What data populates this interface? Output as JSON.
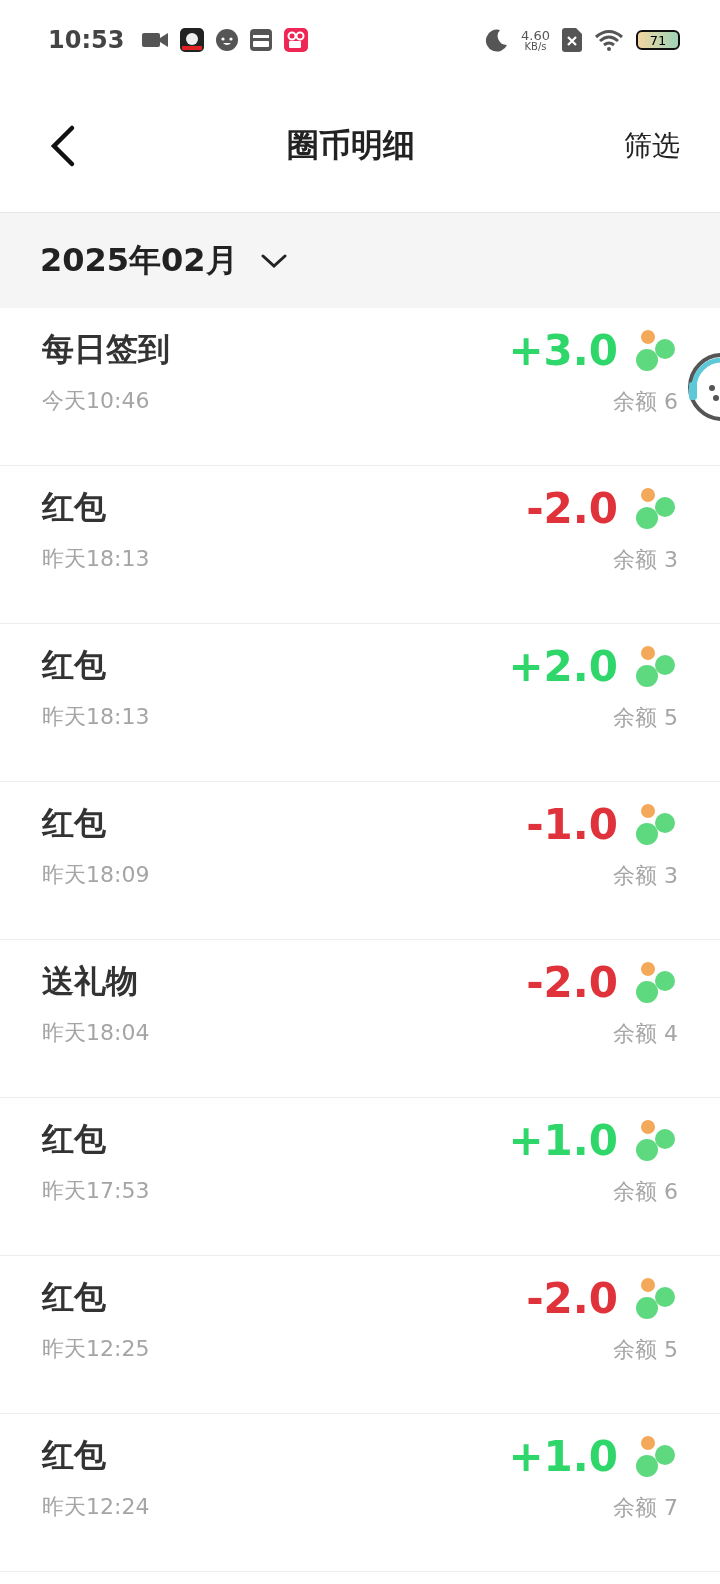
{
  "status_bar": {
    "time": "10:53",
    "speed_value": "4.60",
    "speed_unit": "KB/s",
    "battery": "71"
  },
  "nav": {
    "title": "圈币明细",
    "filter": "筛选"
  },
  "month": {
    "label": "2025年02月"
  },
  "records": [
    {
      "title": "每日签到",
      "time": "今天10:46",
      "kind": "income",
      "amount": "+3.0",
      "balance": "余额 6"
    },
    {
      "title": "红包",
      "time": "昨天18:13",
      "kind": "expense",
      "amount": "-2.0",
      "balance": "余额 3"
    },
    {
      "title": "红包",
      "time": "昨天18:13",
      "kind": "income",
      "amount": "+2.0",
      "balance": "余额 5"
    },
    {
      "title": "红包",
      "time": "昨天18:09",
      "kind": "expense",
      "amount": "-1.0",
      "balance": "余额 3"
    },
    {
      "title": "送礼物",
      "time": "昨天18:04",
      "kind": "expense",
      "amount": "-2.0",
      "balance": "余额 4"
    },
    {
      "title": "红包",
      "time": "昨天17:53",
      "kind": "income",
      "amount": "+1.0",
      "balance": "余额 6"
    },
    {
      "title": "红包",
      "time": "昨天12:25",
      "kind": "expense",
      "amount": "-2.0",
      "balance": "余额 5"
    },
    {
      "title": "红包",
      "time": "昨天12:24",
      "kind": "income",
      "amount": "+1.0",
      "balance": "余额 7"
    }
  ]
}
